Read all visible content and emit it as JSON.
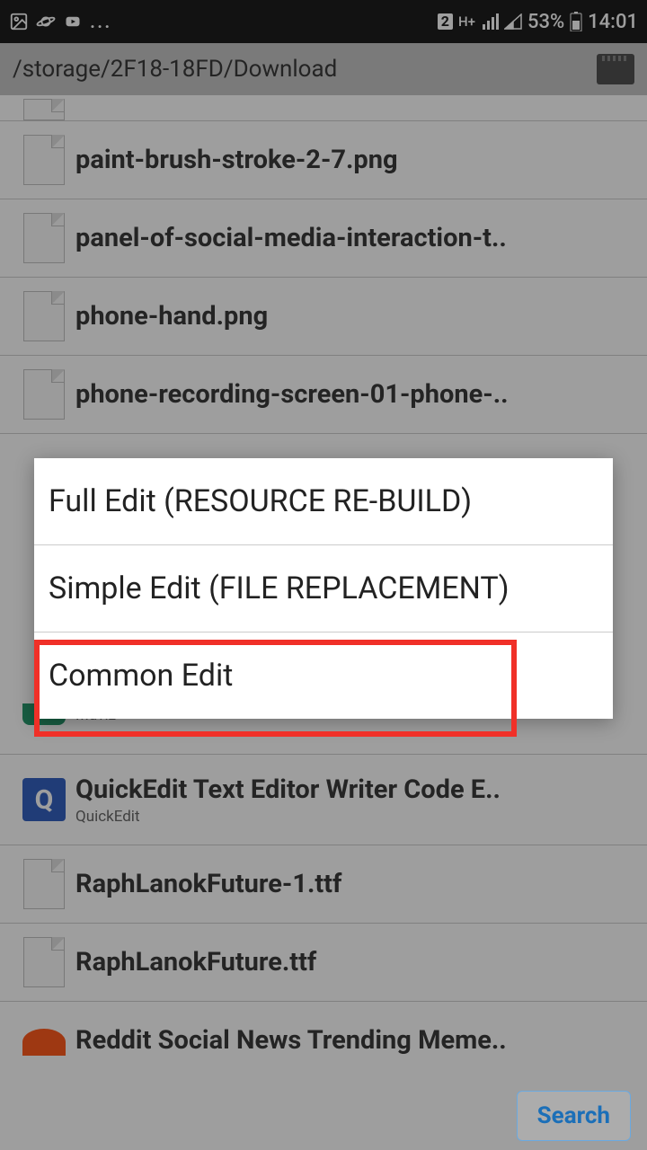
{
  "statusbar": {
    "badge": "2",
    "net": "H+",
    "battery": "53%",
    "time": "14:01"
  },
  "path": "/storage/2F18-18FD/Download",
  "files": [
    {
      "name": "paint-brush-stroke-2-7.png",
      "type": "file"
    },
    {
      "name": "panel-of-social-media-interaction-t..",
      "type": "file"
    },
    {
      "name": "phone-hand.png",
      "type": "file"
    },
    {
      "name": "phone-recording-screen-01-phone-..",
      "type": "file"
    },
    {
      "name": "",
      "sub": "Muviz",
      "type": "app-m"
    },
    {
      "name": "QuickEdit Text Editor Writer Code E..",
      "sub": "QuickEdit",
      "type": "app-q"
    },
    {
      "name": "RaphLanokFuture-1.ttf",
      "type": "file"
    },
    {
      "name": "RaphLanokFuture.ttf",
      "type": "file"
    },
    {
      "name": "Reddit Social News Trending Meme..",
      "type": "app-r"
    }
  ],
  "dialog": {
    "items": [
      "Full Edit (RESOURCE RE-BUILD)",
      "Simple Edit (FILE REPLACEMENT)",
      "Common Edit"
    ]
  },
  "search_label": "Search"
}
